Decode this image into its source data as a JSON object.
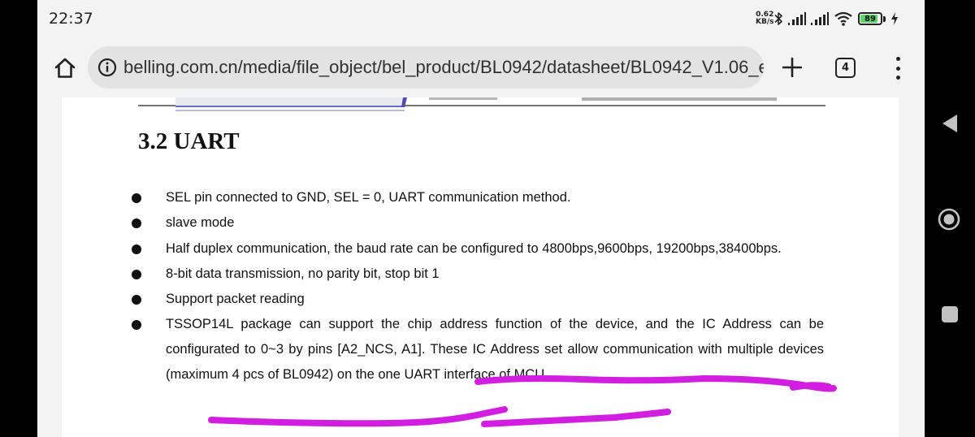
{
  "status_bar": {
    "time": "22:37",
    "net_speed_value": "0.62",
    "net_speed_unit": "KB/s",
    "battery_level": "89",
    "battery_fraction": 0.89,
    "icons": [
      "bluetooth-icon",
      "signal-icon",
      "signal-icon",
      "wifi-icon",
      "battery-icon",
      "charging-icon"
    ]
  },
  "browser": {
    "url": "belling.com.cn/media/file_object/bel_product/BL0942/datasheet/BL0942_V1.06_e",
    "tab_count": "4",
    "icons": [
      "home-icon",
      "info-icon",
      "plus-icon",
      "tabs-icon",
      "more-icon"
    ]
  },
  "document": {
    "heading": "3.2 UART",
    "bullets": [
      {
        "text": "SEL pin connected to GND, SEL = 0, UART communication method."
      },
      {
        "text": "slave mode"
      },
      {
        "text": "Half duplex communication, the baud rate can be configured to 4800bps,9600bps, 19200bps,38400bps."
      },
      {
        "text": "8-bit data transmission, no parity bit, stop bit 1"
      },
      {
        "text": "Support packet reading"
      },
      {
        "text": "TSSOP14L package can support the chip address function of the device, and the IC Address can be configurated to 0~3 by pins [A2_NCS, A1]. These IC Address set allow communication with multiple devices (maximum 4 pcs of BL0942) on the one UART interface of MCU."
      }
    ],
    "annotation_color": "#d21ee0"
  },
  "nav_buttons": {
    "icons": [
      "back-triangle-icon",
      "home-circle-icon",
      "recents-square-icon"
    ]
  }
}
